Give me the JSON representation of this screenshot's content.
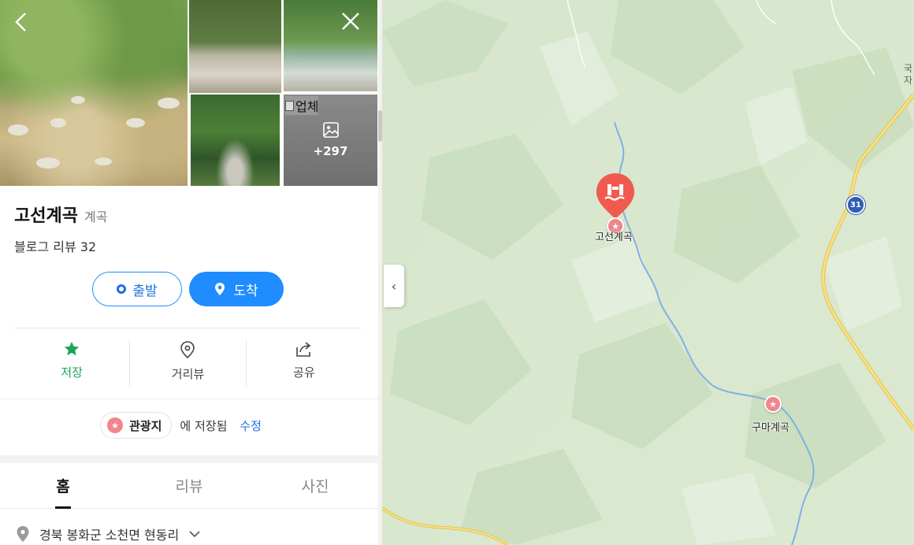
{
  "gallery": {
    "back_icon": "chevron-left-icon",
    "close_icon": "close-icon",
    "broken_alt": "업체",
    "more_count": "+297",
    "more_icon": "image-icon"
  },
  "place": {
    "name": "고선계곡",
    "category": "계곡",
    "review_text": "블로그 리뷰 32"
  },
  "route": {
    "depart_label": "출발",
    "arrive_label": "도착"
  },
  "actions": [
    {
      "label": "저장",
      "icon": "star-icon"
    },
    {
      "label": "거리뷰",
      "icon": "location-pin-icon"
    },
    {
      "label": "공유",
      "icon": "share-icon"
    }
  ],
  "saved": {
    "folder": "관광지",
    "text": "에 저장됨",
    "edit": "수정"
  },
  "tabs": [
    {
      "label": "홈",
      "active": true
    },
    {
      "label": "리뷰",
      "active": false
    },
    {
      "label": "사진",
      "active": false
    }
  ],
  "address": {
    "text": "경북 봉화군 소천면 현동리",
    "icon": "location-pin-icon"
  },
  "map": {
    "selected_label": "고선계곡",
    "poi_label": "구마계곡",
    "route_number": "31",
    "edge_text_1": "국",
    "edge_text_2": "자",
    "accent": "#f05a4f",
    "road_color": "#f7d66a",
    "river_color": "#7fb0e6"
  },
  "colors": {
    "primary": "#1f8cff",
    "saved_green": "#1aa55a",
    "folder_pink": "#f1848c"
  }
}
